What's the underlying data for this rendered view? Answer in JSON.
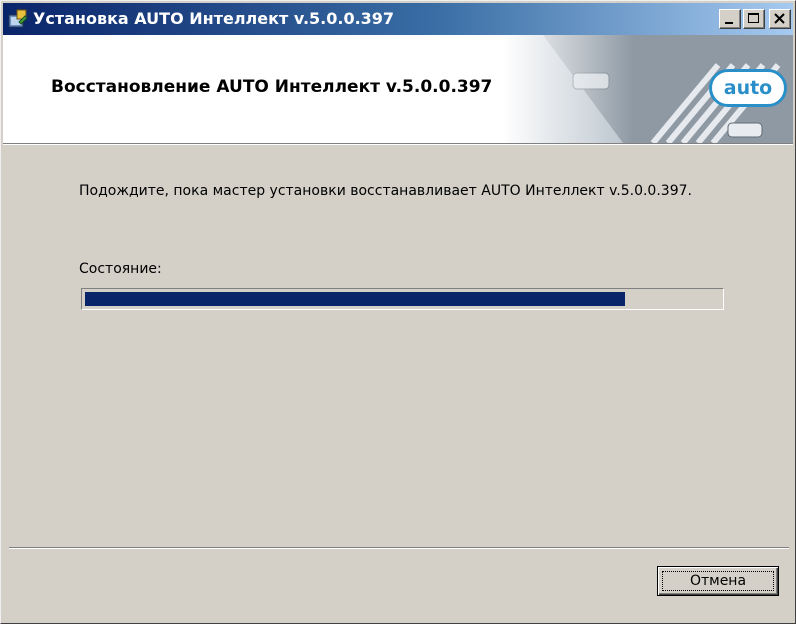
{
  "window": {
    "title": "Установка AUTO Интеллект v.5.0.0.397",
    "icon": "installer-icon",
    "controls": {
      "minimize_icon": "minimize-icon",
      "maximize_icon": "maximize-icon",
      "close_icon": "close-icon"
    }
  },
  "header": {
    "title": "Восстановление AUTO Интеллект v.5.0.0.397",
    "logo_text": "auto"
  },
  "main": {
    "message": "Подождите, пока мастер установки восстанавливает AUTO Интеллект v.5.0.0.397.",
    "status_label": "Состояние:",
    "progress": 0.85
  },
  "footer": {
    "cancel_label": "Отмена"
  },
  "colors": {
    "titlebar_start": "#0a246a",
    "titlebar_end": "#a6caf0",
    "progress_fill": "#0a246a",
    "logo_accent": "#2a8fc9"
  }
}
